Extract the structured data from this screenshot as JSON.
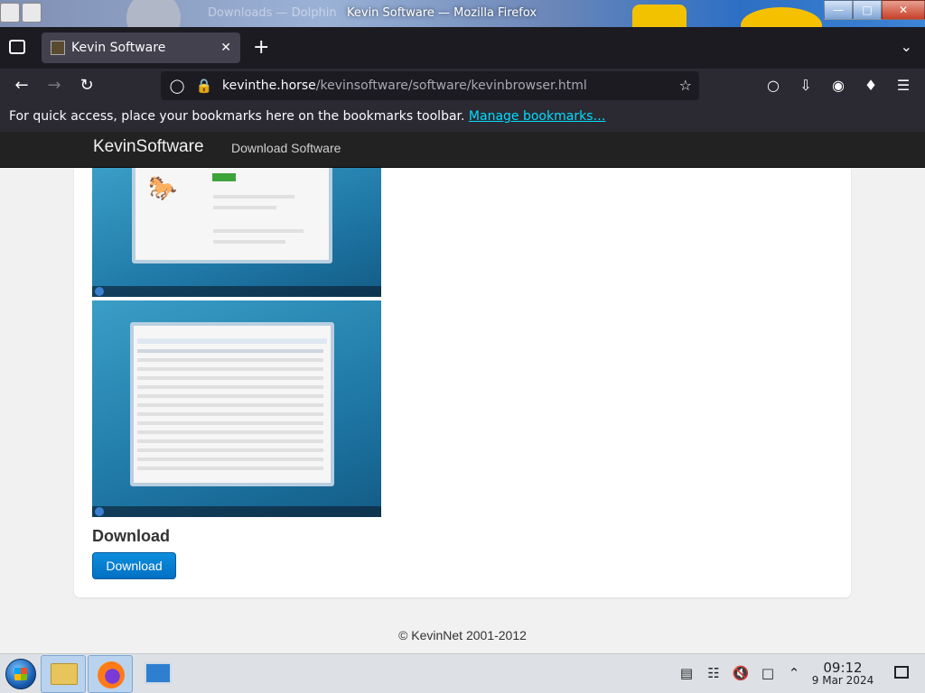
{
  "window": {
    "title": "Kevin Software — Mozilla Firefox",
    "ghost_title": "Downloads — Dolphin"
  },
  "tab": {
    "title": "Kevin Software",
    "close": "✕",
    "new": "+"
  },
  "navbar": {
    "url_domain": "kevinthe.horse",
    "url_path": "/kevinsoftware/software/kevinbrowser.html"
  },
  "bookmarks_bar": {
    "message": "For quick access, place your bookmarks here on the bookmarks toolbar.",
    "link": "Manage bookmarks…"
  },
  "site": {
    "brand": "KevinSoftware",
    "nav_link": "Download Software"
  },
  "main": {
    "download_heading": "Download",
    "download_button": "Download",
    "footer": "© KevinNet 2001-2012"
  },
  "taskbar": {
    "time": "09:12",
    "date": "9 Mar 2024"
  },
  "colors": {
    "tab_strip": "#1c1b22",
    "toolbar": "#2b2a33",
    "link": "#00ddff",
    "site_nav": "#222222",
    "button_blue": "#0d8edc"
  }
}
